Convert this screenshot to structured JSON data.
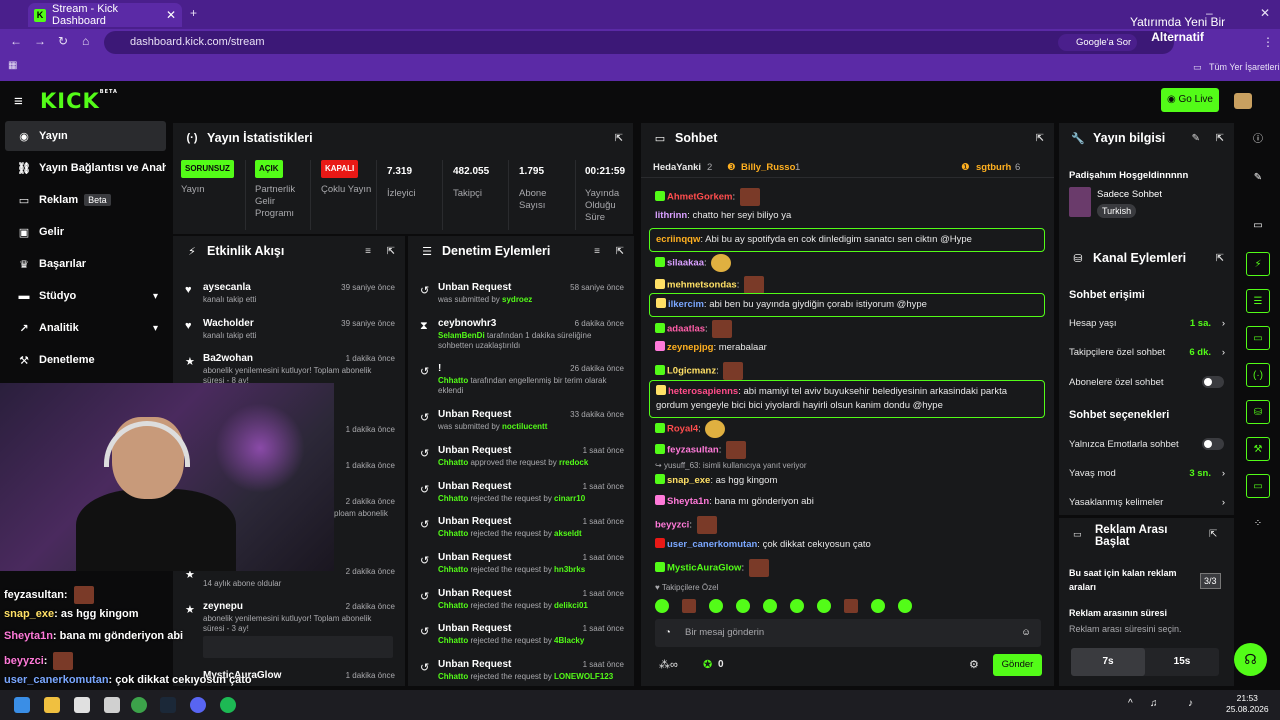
{
  "browser": {
    "tab_title": "Stream - Kick Dashboard",
    "url": "dashboard.kick.com/stream",
    "google_search": "Google'a Sor",
    "bookmarks_label": "Tüm Yer İşaretleri",
    "promo_line1": "Yatırımda Yeni Bir",
    "promo_line2": "Alternatif"
  },
  "header": {
    "logo": "KICK",
    "logo_tag": "BETA",
    "go_live": "Go Live"
  },
  "sidebar": {
    "items": [
      {
        "label": "Yayın",
        "icon": "broadcast-icon"
      },
      {
        "label": "Yayın Bağlantısı ve Anahtarı",
        "icon": "link-icon"
      },
      {
        "label": "Reklam",
        "icon": "ad-icon",
        "badge": "Beta"
      },
      {
        "label": "Gelir",
        "icon": "money-icon"
      },
      {
        "label": "Başarılar",
        "icon": "trophy-icon"
      },
      {
        "label": "Stüdyo",
        "icon": "studio-icon"
      },
      {
        "label": "Analitik",
        "icon": "analytics-icon"
      },
      {
        "label": "Denetleme",
        "icon": "hammer-icon"
      }
    ]
  },
  "stats": {
    "title": "Yayın İstatistikleri",
    "items": [
      {
        "badge": "SORUNSUZ",
        "label": "Yayın"
      },
      {
        "badge": "AÇIK",
        "label": "Partnerlik Gelir Programı"
      },
      {
        "badge": "KAPALI",
        "label": "Çoklu Yayın"
      },
      {
        "value": "7.319",
        "label": "İzleyici"
      },
      {
        "value": "482.055",
        "label": "Takipçi"
      },
      {
        "value": "1.795",
        "label": "Abone Sayısı"
      },
      {
        "value": "00:21:59",
        "label": "Yayında Olduğu Süre"
      }
    ]
  },
  "activity": {
    "title": "Etkinlik Akışı",
    "rows": [
      {
        "name": "aysecanla",
        "sub": "kanalı takip etti",
        "time": "39 saniye önce"
      },
      {
        "name": "Wacholder",
        "sub": "kanalı takip etti",
        "time": "39 saniye önce"
      },
      {
        "name": "Ba2wohan",
        "sub": "abonelik yenilemesini kutluyor! Toplam abonelik süresi - 8 ay!",
        "time": "1 dakika önce"
      },
      {
        "time": "1 dakika önce"
      },
      {
        "time": "1 dakika önce"
      },
      {
        "time": "2 dakika önce"
      },
      {
        "sub": "ploam abonelik"
      },
      {
        "time": "2 dakika önce",
        "sub": "14 aylık abone oldular"
      },
      {
        "name": "zeynepu",
        "sub": "abonelik yenilemesini kutluyor! Toplam abonelik süresi - 3 ay!",
        "time": "2 dakika önce"
      },
      {
        "name": "MysticAuraGlow",
        "time": "1 dakika önce"
      }
    ]
  },
  "moderation": {
    "title": "Denetim Eylemleri",
    "rows": [
      {
        "title": "Unban Request",
        "sub_pre": "was submitted by ",
        "user": "sydroez",
        "time": "58 saniye önce"
      },
      {
        "title": "ceybnowhr3",
        "user": "SelamBenDi",
        "sub_post": " tarafından 1 dakika süreliğine sohbetten uzaklaştırıldı",
        "time": "6 dakika önce"
      },
      {
        "title": "!",
        "user": "Chhatto",
        "sub_post": " tarafından engellenmiş bir terim olarak eklendi",
        "time": "26 dakika önce"
      },
      {
        "title": "Unban Request",
        "sub_pre": "was submitted by ",
        "user": "noctilucentt",
        "time": "33 dakika önce"
      },
      {
        "title": "Unban Request",
        "user": "Chhatto",
        "sub_post": " approved the request by ",
        "user2": "rredock",
        "time": "1 saat önce"
      },
      {
        "title": "Unban Request",
        "user": "Chhatto",
        "sub_post": " rejected the request by ",
        "user2": "cinarr10",
        "time": "1 saat önce"
      },
      {
        "title": "Unban Request",
        "user": "Chhatto",
        "sub_post": " rejected the request by ",
        "user2": "akseldt",
        "time": "1 saat önce"
      },
      {
        "title": "Unban Request",
        "user": "Chhatto",
        "sub_post": " rejected the request by ",
        "user2": "hn3brks",
        "time": "1 saat önce"
      },
      {
        "title": "Unban Request",
        "user": "Chhatto",
        "sub_post": " rejected the request by ",
        "user2": "delikci01",
        "time": "1 saat önce"
      },
      {
        "title": "Unban Request",
        "user": "Chhatto",
        "sub_post": " rejected the request by ",
        "user2": "4Blacky",
        "time": "1 saat önce"
      },
      {
        "title": "Unban Request",
        "user": "Chhatto",
        "sub_post": " rejected the request by ",
        "user2": "LONEWOLF123",
        "time": "1 saat önce"
      }
    ]
  },
  "chat": {
    "title": "Sohbet",
    "top_users": [
      {
        "name": "HedaYanki",
        "count": "2"
      },
      {
        "name": "Billy_Russo",
        "count": "1"
      },
      {
        "name": "sgtburh",
        "count": "6"
      }
    ],
    "messages": [
      {
        "name": "AhmetGorkem",
        "color": "#ff4d4d",
        "text": ""
      },
      {
        "name": "lithrinn",
        "color": "#d9a0ff",
        "text": "chatto her seyi biliyo ya"
      },
      {
        "name": "ecriinqqw",
        "color": "#ffb020",
        "text": "Abi bu ay spotifyda en cok dinledigim sanatcı sen ciktın @Hype",
        "boxed": true
      },
      {
        "name": "silaakaa",
        "color": "#d9a0ff",
        "text": ""
      },
      {
        "name": "mehmetsondas",
        "color": "#ffe066",
        "text": ""
      },
      {
        "name": "ilkercim",
        "color": "#7aa7ff",
        "text": "abi ben bu yayında giydiğin çorabı istiyorum @hype",
        "boxed": true
      },
      {
        "name": "adaatlas",
        "color": "#ff5ea8",
        "text": ""
      },
      {
        "name": "zeynepjpg",
        "color": "#ffb020",
        "text": "merabalaar"
      },
      {
        "name": "L0gicmanz",
        "color": "#ffe066",
        "text": ""
      },
      {
        "name": "heterosapienns",
        "color": "#ff4d8a",
        "text": "abi mamiyi tel aviv buyuksehir belediyesinin arkasindaki parkta gordum yengeyle bici bici yiyolardi hayirli olsun kanim dondu @hype",
        "boxed": true
      },
      {
        "name": "Royal4",
        "color": "#ff4d4d",
        "text": ""
      },
      {
        "name": "feyzasultan",
        "color": "#ff7ad9",
        "text": ""
      },
      {
        "reply": "yusuff_63: isimli kullanıcıya yanıt veriyor"
      },
      {
        "name": "snap_exe",
        "color": "#ffe066",
        "text": "as hgg kingom"
      },
      {
        "name": "Sheyta1n",
        "color": "#ff7ad9",
        "text": "bana mı gönderiyon abi"
      },
      {
        "name": "beyyzci",
        "color": "#ff7ad9",
        "text": ""
      },
      {
        "name": "user_canerkomutan",
        "color": "#7aa7ff",
        "text": "çok dikkat cekıyosun çato"
      },
      {
        "name": "MysticAuraGlow",
        "color": "#53fc18",
        "text": ""
      }
    ],
    "followers_only": "Takipçilere Özel",
    "input_placeholder": "Bir mesaj gönderin",
    "points": "0",
    "send": "Gönder"
  },
  "info": {
    "title": "Yayın bilgisi",
    "stream_title": "Padişahım Hoşgeldinnnnn",
    "category": "Sadece Sohbet",
    "language": "Turkish"
  },
  "channel_actions": {
    "title": "Kanal Eylemleri",
    "chat_access": "Sohbet erişimi",
    "account_age": "Hesap yaşı",
    "account_age_val": "1 sa.",
    "followers_only_chat": "Takipçilere özel sohbet",
    "followers_only_val": "6 dk.",
    "subs_only_chat": "Abonelere özel sohbet",
    "chat_options": "Sohbet seçenekleri",
    "emotes_only": "Yalnızca Emotlarla sohbet",
    "slow_mode": "Yavaş mod",
    "slow_mode_val": "3 sn.",
    "banned_words": "Yasaklanmış kelimeler"
  },
  "ad_break": {
    "title": "Reklam Arası Başlat",
    "remaining_label": "Bu saat için kalan reklam araları",
    "remaining_val": "3/3",
    "duration_label": "Reklam arasının süresi",
    "duration_hint": "Reklam arası süresini seçin.",
    "opt1": "7s",
    "opt2": "15s"
  },
  "overlay_chat": [
    {
      "name": "feyzasultan",
      "text": ":"
    },
    {
      "name": "snap_exe",
      "text": ": as hgg kingom"
    },
    {
      "name": "Sheyta1n",
      "text": ": bana mı gönderiyon abi"
    },
    {
      "name": "beyyzci",
      "text": ":"
    },
    {
      "name": "user_canerkomutan",
      "text": ": çok dikkat cekıyosun çato"
    }
  ],
  "taskbar": {
    "time": "21:53",
    "date": "25.08.2026"
  },
  "colors": {
    "accent": "#53fc18",
    "panel": "#18191b",
    "browser": "#5b2aa6"
  }
}
